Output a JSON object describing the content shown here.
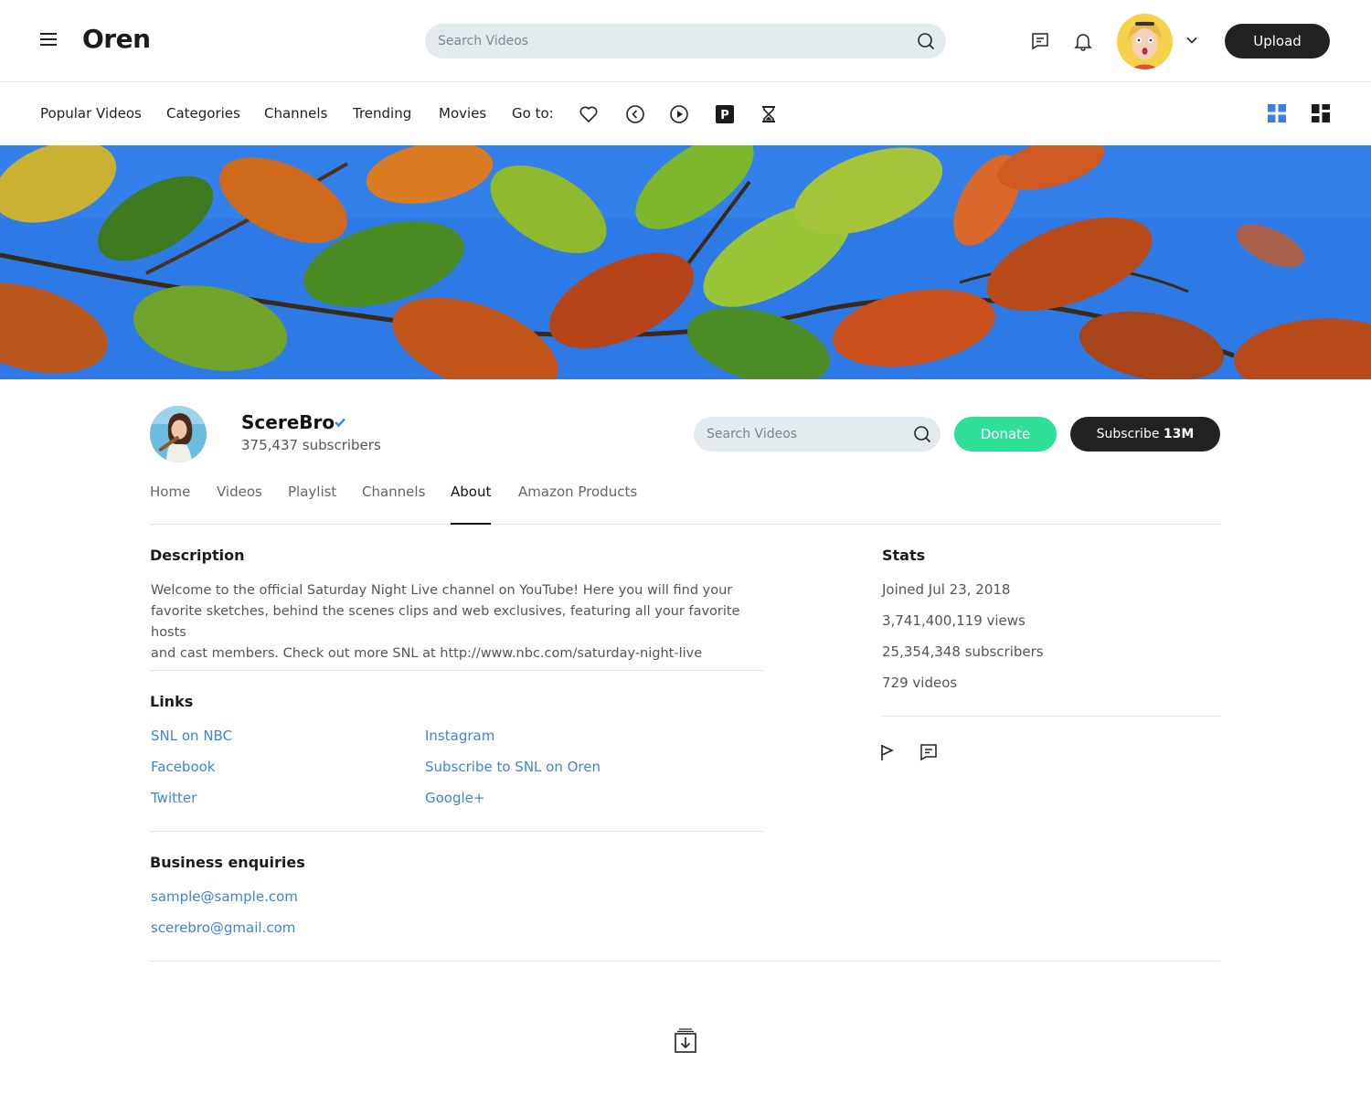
{
  "header": {
    "logo": "Oren",
    "search_placeholder": "Search Videos",
    "upload_label": "Upload"
  },
  "nav": {
    "items": [
      "Popular Videos",
      "Categories",
      "Channels",
      "Trending",
      "Movies"
    ],
    "goto_label": "Go to:",
    "goto_icons": [
      "heart-icon",
      "rewind-icon",
      "play-icon",
      "parking-icon",
      "hourglass-icon"
    ],
    "view_icons": [
      "grid-view-icon",
      "mosaic-view-icon"
    ]
  },
  "channel": {
    "name": "ScereBro",
    "subscribers": "375,437 subscribers",
    "search_placeholder": "Search Videos",
    "donate_label": "Donate",
    "subscribe_label": "Subscribe",
    "subscribe_count": "13M"
  },
  "tabs": [
    {
      "label": "Home",
      "active": false
    },
    {
      "label": "Videos",
      "active": false
    },
    {
      "label": "Playlist",
      "active": false
    },
    {
      "label": "Channels",
      "active": false
    },
    {
      "label": "About",
      "active": true
    },
    {
      "label": "Amazon Products",
      "active": false
    }
  ],
  "about": {
    "description_title": "Description",
    "description_lines": [
      "Welcome to the official Saturday Night Live channel on YouTube!  Here you will find your",
      "favorite sketches, behind the scenes clips and web exclusives, featuring all your favorite hosts",
      "and cast members.  Check out more SNL at http://www.nbc.com/saturday-night-live"
    ],
    "links_title": "Links",
    "links_left": [
      "SNL on NBC",
      "Facebook",
      "Twitter"
    ],
    "links_right": [
      "Instagram",
      "Subscribe to SNL on Oren",
      "Google+"
    ],
    "business_title": "Business enquiries",
    "emails": [
      "sample@sample.com",
      "scerebro@gmail.com"
    ],
    "stats_title": "Stats",
    "stats": [
      "Joined Jul 23, 2018",
      "3,741,400,119 views",
      "25,354,348 subscribers",
      "729 videos"
    ]
  },
  "colors": {
    "accent_blue": "#3c86d6",
    "donate_green": "#2ee09a",
    "dark": "#222222",
    "search_bg": "#e4ebef"
  }
}
